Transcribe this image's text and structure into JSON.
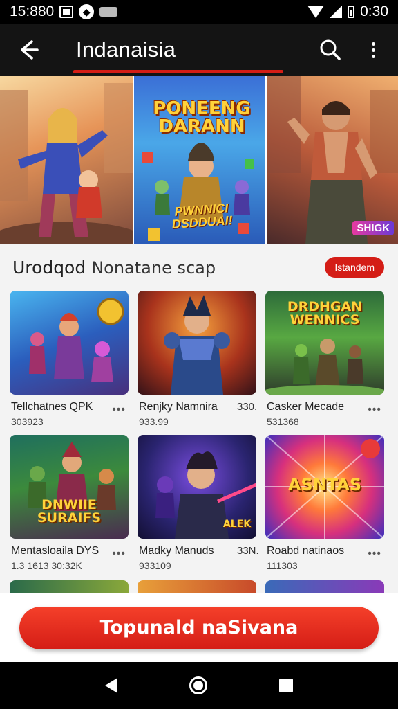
{
  "status_bar": {
    "time_left": "15:880",
    "time_right": "0:30",
    "icons": [
      "image-icon",
      "notification-icon",
      "pill-icon",
      "wifi-icon",
      "signal-icon",
      "battery-icon"
    ]
  },
  "app_bar": {
    "title": "Indanaisia",
    "icons": [
      "back-arrow-icon",
      "search-icon",
      "more-vert-icon"
    ]
  },
  "banner": {
    "slides": [
      {
        "tag": "",
        "title": "",
        "subtitle": ""
      },
      {
        "tag": "",
        "title": "PONEENG DARANN",
        "subtitle": "PWNNICI DSDDUAI!"
      },
      {
        "tag": "",
        "logo": "SHIGK"
      }
    ]
  },
  "section": {
    "title": "Urodqod",
    "subtitle": "Nonatane scap",
    "see_all_label": "Istandem"
  },
  "cards": [
    {
      "tag": "",
      "thumb_title": "",
      "name": "Tellchatnes QPK",
      "count": "",
      "meta": "303923"
    },
    {
      "tag": "",
      "thumb_title": "",
      "name": "Renjky Namnira",
      "count": "330.",
      "meta": "933.99"
    },
    {
      "tag": "",
      "thumb_title": "DRDHGAN WENNICS",
      "name": "Casker Mecade",
      "count": "",
      "meta": "531368"
    },
    {
      "tag": "",
      "thumb_title": "DNWIIE SURAIFS",
      "name": "Mentasloaila DYS",
      "count": "",
      "meta": "1.3 1613 30:32K"
    },
    {
      "tag": "",
      "thumb_title": "ALEK",
      "name": "Madky Manuds",
      "count": "33N.",
      "meta": "933109"
    },
    {
      "tag": "",
      "thumb_title": "ASNTAS",
      "name": "Roabd natinaos",
      "count": "",
      "meta": "111303"
    }
  ],
  "more_dots": "•••",
  "cta": {
    "label": "Topunald naSivana"
  },
  "nav_bar": {
    "icons": [
      "nav-back-icon",
      "nav-home-icon",
      "nav-recent-icon"
    ]
  },
  "colors": {
    "accent": "#d41d16",
    "app_bar_bg": "#141414",
    "page_bg": "#f3f3f3"
  }
}
